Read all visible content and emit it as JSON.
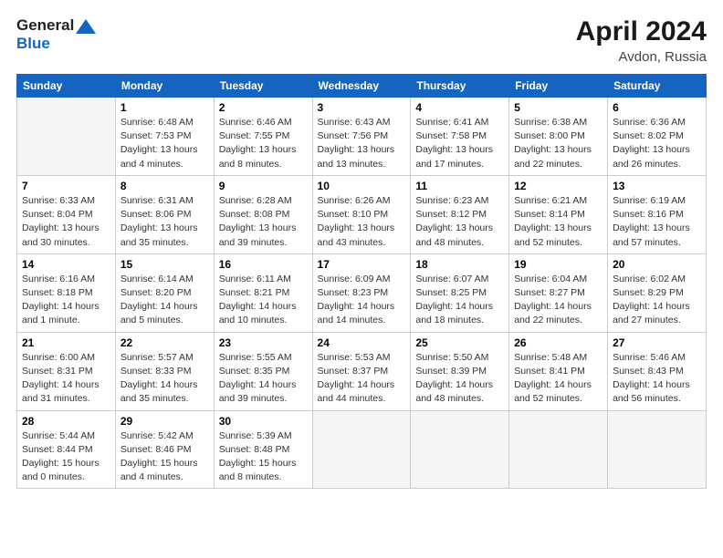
{
  "header": {
    "logo_line1": "General",
    "logo_line2": "Blue",
    "title": "April 2024",
    "location": "Avdon, Russia"
  },
  "weekdays": [
    "Sunday",
    "Monday",
    "Tuesday",
    "Wednesday",
    "Thursday",
    "Friday",
    "Saturday"
  ],
  "weeks": [
    [
      {
        "day": "",
        "empty": true
      },
      {
        "day": "1",
        "sunrise": "6:48 AM",
        "sunset": "7:53 PM",
        "daylight": "13 hours and 4 minutes."
      },
      {
        "day": "2",
        "sunrise": "6:46 AM",
        "sunset": "7:55 PM",
        "daylight": "13 hours and 8 minutes."
      },
      {
        "day": "3",
        "sunrise": "6:43 AM",
        "sunset": "7:56 PM",
        "daylight": "13 hours and 13 minutes."
      },
      {
        "day": "4",
        "sunrise": "6:41 AM",
        "sunset": "7:58 PM",
        "daylight": "13 hours and 17 minutes."
      },
      {
        "day": "5",
        "sunrise": "6:38 AM",
        "sunset": "8:00 PM",
        "daylight": "13 hours and 22 minutes."
      },
      {
        "day": "6",
        "sunrise": "6:36 AM",
        "sunset": "8:02 PM",
        "daylight": "13 hours and 26 minutes."
      }
    ],
    [
      {
        "day": "7",
        "sunrise": "6:33 AM",
        "sunset": "8:04 PM",
        "daylight": "13 hours and 30 minutes."
      },
      {
        "day": "8",
        "sunrise": "6:31 AM",
        "sunset": "8:06 PM",
        "daylight": "13 hours and 35 minutes."
      },
      {
        "day": "9",
        "sunrise": "6:28 AM",
        "sunset": "8:08 PM",
        "daylight": "13 hours and 39 minutes."
      },
      {
        "day": "10",
        "sunrise": "6:26 AM",
        "sunset": "8:10 PM",
        "daylight": "13 hours and 43 minutes."
      },
      {
        "day": "11",
        "sunrise": "6:23 AM",
        "sunset": "8:12 PM",
        "daylight": "13 hours and 48 minutes."
      },
      {
        "day": "12",
        "sunrise": "6:21 AM",
        "sunset": "8:14 PM",
        "daylight": "13 hours and 52 minutes."
      },
      {
        "day": "13",
        "sunrise": "6:19 AM",
        "sunset": "8:16 PM",
        "daylight": "13 hours and 57 minutes."
      }
    ],
    [
      {
        "day": "14",
        "sunrise": "6:16 AM",
        "sunset": "8:18 PM",
        "daylight": "14 hours and 1 minute."
      },
      {
        "day": "15",
        "sunrise": "6:14 AM",
        "sunset": "8:20 PM",
        "daylight": "14 hours and 5 minutes."
      },
      {
        "day": "16",
        "sunrise": "6:11 AM",
        "sunset": "8:21 PM",
        "daylight": "14 hours and 10 minutes."
      },
      {
        "day": "17",
        "sunrise": "6:09 AM",
        "sunset": "8:23 PM",
        "daylight": "14 hours and 14 minutes."
      },
      {
        "day": "18",
        "sunrise": "6:07 AM",
        "sunset": "8:25 PM",
        "daylight": "14 hours and 18 minutes."
      },
      {
        "day": "19",
        "sunrise": "6:04 AM",
        "sunset": "8:27 PM",
        "daylight": "14 hours and 22 minutes."
      },
      {
        "day": "20",
        "sunrise": "6:02 AM",
        "sunset": "8:29 PM",
        "daylight": "14 hours and 27 minutes."
      }
    ],
    [
      {
        "day": "21",
        "sunrise": "6:00 AM",
        "sunset": "8:31 PM",
        "daylight": "14 hours and 31 minutes."
      },
      {
        "day": "22",
        "sunrise": "5:57 AM",
        "sunset": "8:33 PM",
        "daylight": "14 hours and 35 minutes."
      },
      {
        "day": "23",
        "sunrise": "5:55 AM",
        "sunset": "8:35 PM",
        "daylight": "14 hours and 39 minutes."
      },
      {
        "day": "24",
        "sunrise": "5:53 AM",
        "sunset": "8:37 PM",
        "daylight": "14 hours and 44 minutes."
      },
      {
        "day": "25",
        "sunrise": "5:50 AM",
        "sunset": "8:39 PM",
        "daylight": "14 hours and 48 minutes."
      },
      {
        "day": "26",
        "sunrise": "5:48 AM",
        "sunset": "8:41 PM",
        "daylight": "14 hours and 52 minutes."
      },
      {
        "day": "27",
        "sunrise": "5:46 AM",
        "sunset": "8:43 PM",
        "daylight": "14 hours and 56 minutes."
      }
    ],
    [
      {
        "day": "28",
        "sunrise": "5:44 AM",
        "sunset": "8:44 PM",
        "daylight": "15 hours and 0 minutes."
      },
      {
        "day": "29",
        "sunrise": "5:42 AM",
        "sunset": "8:46 PM",
        "daylight": "15 hours and 4 minutes."
      },
      {
        "day": "30",
        "sunrise": "5:39 AM",
        "sunset": "8:48 PM",
        "daylight": "15 hours and 8 minutes."
      },
      {
        "day": "",
        "empty": true
      },
      {
        "day": "",
        "empty": true
      },
      {
        "day": "",
        "empty": true
      },
      {
        "day": "",
        "empty": true
      }
    ]
  ]
}
